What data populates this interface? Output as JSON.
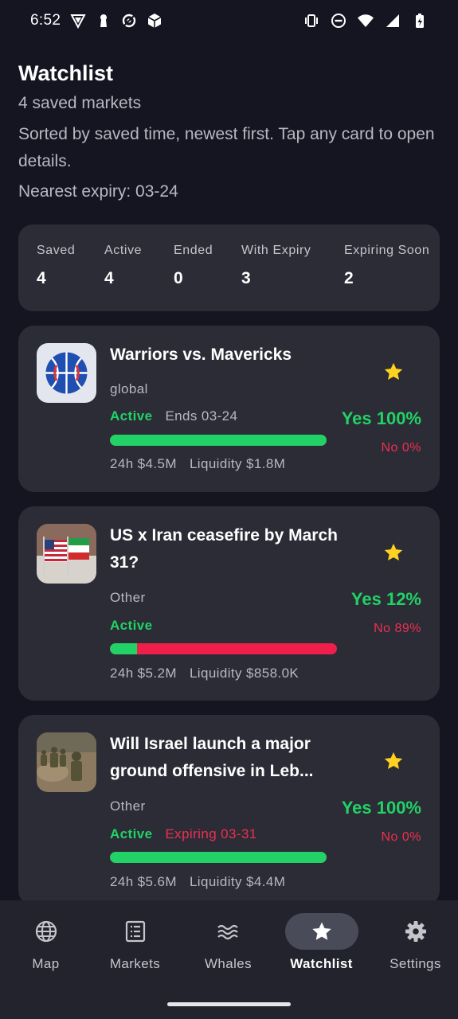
{
  "status_bar": {
    "time": "6:52",
    "left_icons": [
      "vpn-shield-icon",
      "keyhole-icon",
      "sync-icon",
      "box-icon"
    ],
    "right_icons": [
      "vibrate-icon",
      "do-not-disturb-icon",
      "wifi-icon",
      "signal-icon",
      "battery-charging-icon"
    ]
  },
  "header": {
    "title": "Watchlist",
    "subtitle": "4 saved markets",
    "description": "Sorted by saved time, newest first. Tap any card to open details.",
    "nearest_expiry": "Nearest expiry: 03-24"
  },
  "stats": [
    {
      "label": "Saved",
      "value": "4"
    },
    {
      "label": "Active",
      "value": "4"
    },
    {
      "label": "Ended",
      "value": "0"
    },
    {
      "label": "With Expiry",
      "value": "3"
    },
    {
      "label": "Expiring Soon",
      "value": "2"
    }
  ],
  "markets": [
    {
      "title": "Warriors vs. Mavericks",
      "category": "global",
      "status": "Active",
      "expiry_text": "Ends 03-24",
      "expiry_style": "normal",
      "yes": "Yes 100%",
      "no": "No 0%",
      "yes_fraction": 1.0,
      "volume_24h": "24h $4.5M",
      "liquidity": "Liquidity $1.8M",
      "thumbnail": "basketball-icon"
    },
    {
      "title": "US x Iran ceasefire by March 31?",
      "category": "Other",
      "status": "Active",
      "expiry_text": "",
      "expiry_style": "none",
      "yes": "Yes 12%",
      "no": "No 89%",
      "yes_fraction": 0.12,
      "volume_24h": "24h $5.2M",
      "liquidity": "Liquidity $858.0K",
      "thumbnail": "flags-image"
    },
    {
      "title": "Will Israel launch a major ground offensive in Leb...",
      "category": "Other",
      "status": "Active",
      "expiry_text": "Expiring 03-31",
      "expiry_style": "warning",
      "yes": "Yes 100%",
      "no": "No 0%",
      "yes_fraction": 1.0,
      "volume_24h": "24h $5.6M",
      "liquidity": "Liquidity $4.4M",
      "thumbnail": "soldiers-image"
    }
  ],
  "nav": [
    {
      "label": "Map",
      "icon": "globe-icon",
      "active": false
    },
    {
      "label": "Markets",
      "icon": "list-icon",
      "active": false
    },
    {
      "label": "Whales",
      "icon": "waves-icon",
      "active": false
    },
    {
      "label": "Watchlist",
      "icon": "star-icon",
      "active": true
    },
    {
      "label": "Settings",
      "icon": "gear-icon",
      "active": false
    }
  ],
  "colors": {
    "background": "#141521",
    "card": "#2b2c36",
    "yes_green": "#22d266",
    "no_red": "#ef2f4f",
    "star_yellow": "#ffd21f"
  }
}
